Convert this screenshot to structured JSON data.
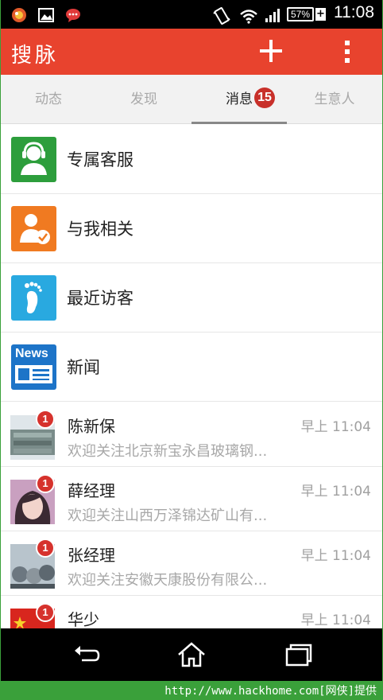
{
  "status_bar": {
    "battery_percent": "57%",
    "battery_plus": "+",
    "time": "11:08",
    "icons": [
      "game-app-icon",
      "gallery-icon",
      "chat-bubble-icon",
      "vibrate-icon",
      "wifi-icon",
      "signal-icon",
      "battery-icon"
    ]
  },
  "app_bar": {
    "title": "搜脉",
    "add_icon": "plus-icon",
    "menu_icon": "more-vertical-icon"
  },
  "tabs": [
    {
      "label": "动态",
      "active": false
    },
    {
      "label": "发现",
      "active": false
    },
    {
      "label": "消息",
      "active": true,
      "badge": "15"
    },
    {
      "label": "生意人",
      "active": false
    }
  ],
  "features": [
    {
      "label": "专属客服",
      "icon": "customer-service-icon",
      "color": "#2d9e3c"
    },
    {
      "label": "与我相关",
      "icon": "person-check-icon",
      "color": "#f07a21"
    },
    {
      "label": "最近访客",
      "icon": "footprint-icon",
      "color": "#29a9e0"
    },
    {
      "label": "新闻",
      "icon": "news-icon",
      "color": "#1d74c8",
      "icon_text": "News"
    }
  ],
  "contacts": [
    {
      "name": "陈新保",
      "time": "早上 11:04",
      "preview": "欢迎关注北京新宝永昌玻璃钢...",
      "unread": "1"
    },
    {
      "name": "薛经理",
      "time": "早上 11:04",
      "preview": "欢迎关注山西万泽锦达矿山有...",
      "unread": "1"
    },
    {
      "name": "张经理",
      "time": "早上 11:04",
      "preview": "欢迎关注安徽天康股份有限公...",
      "unread": "1"
    },
    {
      "name": "华少",
      "time": "早上 11:04",
      "preview": "",
      "unread": "1"
    }
  ],
  "nav_bar": {
    "icons": [
      "back-icon",
      "home-icon",
      "recent-apps-icon"
    ]
  },
  "footer": {
    "url": "http://www.hackhome.com[网侠]提供"
  },
  "colors": {
    "accent": "#e8432e",
    "badge": "#d6322d",
    "frame": "#3aa03a"
  }
}
